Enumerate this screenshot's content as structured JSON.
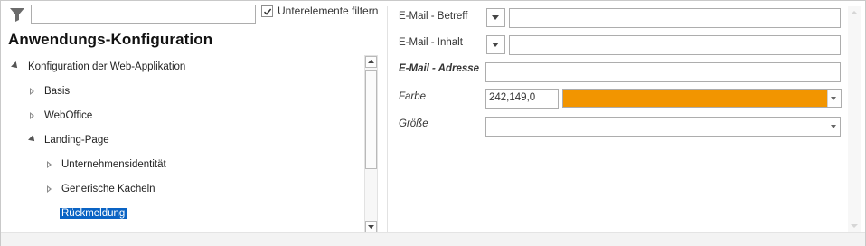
{
  "left_panel": {
    "filter_icon": "funnel-icon",
    "filter_input_value": "",
    "subelements_checkbox": {
      "checked": true,
      "label": "Unterelemente filtern"
    },
    "title": "Anwendungs-Konfiguration",
    "tree": [
      {
        "label": "Konfiguration der Web-Applikation",
        "expanded": true,
        "level": 0
      },
      {
        "label": "Basis",
        "expanded": false,
        "level": 1
      },
      {
        "label": "WebOffice",
        "expanded": false,
        "level": 1
      },
      {
        "label": "Landing-Page",
        "expanded": true,
        "level": 1
      },
      {
        "label": "Unternehmensidentität",
        "expanded": false,
        "level": 2
      },
      {
        "label": "Generische Kacheln",
        "expanded": false,
        "level": 2
      },
      {
        "label": "Rückmeldung",
        "selected": true,
        "level": 2
      }
    ]
  },
  "right_panel": {
    "fields": {
      "email_subject": {
        "label": "E-Mail - Betreff",
        "value": ""
      },
      "email_body": {
        "label": "E-Mail - Inhalt",
        "value": ""
      },
      "email_address": {
        "label": "E-Mail - Adresse",
        "value": ""
      },
      "color": {
        "label": "Farbe",
        "rgb_value": "242,149,0",
        "swatch_color": "#F29500"
      },
      "size": {
        "label": "Größe",
        "value": ""
      }
    }
  },
  "colors": {
    "selection": "#0A63C4",
    "accent_orange": "#F29500"
  }
}
